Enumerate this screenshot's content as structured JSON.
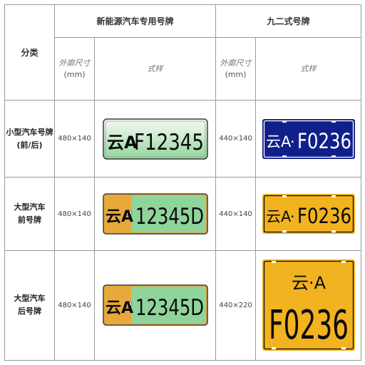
{
  "table": {
    "header_category": "分类",
    "col_group_new_energy": "新能源汽车专用号牌",
    "col_group_92": "九二式号牌",
    "sub_size_label": "外廓尺寸",
    "sub_size_unit": "(mm)",
    "sub_style_label": "式样"
  },
  "rows": [
    {
      "label_line1": "小型汽车号牌",
      "label_line2": "(前/后)",
      "ne_size": "480×140",
      "ne_plate": {
        "province": "云A",
        "number": "F12345",
        "colors": {
          "bg_top": "#f4f8f2",
          "bg_bottom": "#8fd49a",
          "text": "#0b0b0b",
          "border": "#3a3a3a"
        }
      },
      "std_size": "440×140",
      "std_plate": {
        "province": "云A",
        "dot": "·",
        "number": "F0236",
        "colors": {
          "bg": "#10208a",
          "text": "#ffffff",
          "border": "#ffffff"
        }
      }
    },
    {
      "label_line1": "大型汽车",
      "label_line2": "前号牌",
      "ne_size": "480×140",
      "ne_plate": {
        "province": "云A",
        "number": "12345D",
        "colors": {
          "left_bg": "#e8a83a",
          "right_bg": "#8fd49a",
          "text": "#0b0b0b",
          "border": "#3a3a3a"
        }
      },
      "std_size": "440×140",
      "std_plate": {
        "province": "云A",
        "dot": "·",
        "number": "F0236",
        "colors": {
          "bg": "#f2b320",
          "text": "#0b0b0b",
          "border": "#0b0b0b"
        }
      }
    },
    {
      "label_line1": "大型汽车",
      "label_line2": "后号牌",
      "ne_size": "480×140",
      "ne_plate": {
        "province": "云A",
        "number": "12345D",
        "colors": {
          "left_bg": "#e8a83a",
          "right_bg": "#8fd49a",
          "text": "#0b0b0b",
          "border": "#3a3a3a"
        }
      },
      "std_size": "440×220",
      "std_plate": {
        "province_top": "云·A",
        "number": "F0236",
        "colors": {
          "bg": "#f2b320",
          "text": "#0b0b0b",
          "border": "#0b0b0b"
        }
      }
    }
  ]
}
